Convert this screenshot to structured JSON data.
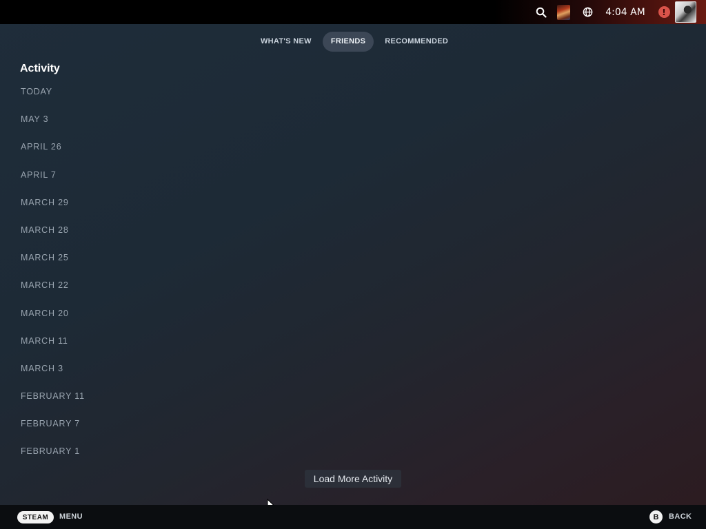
{
  "status_bar": {
    "time": "4:04 AM",
    "icons": [
      "search-icon",
      "game-thumbnail",
      "globe-icon",
      "alert-icon",
      "avatar"
    ],
    "alert_symbol": "!"
  },
  "tabs": [
    {
      "label": "WHAT'S NEW",
      "active": false
    },
    {
      "label": "FRIENDS",
      "active": true
    },
    {
      "label": "RECOMMENDED",
      "active": false
    }
  ],
  "activity": {
    "title": "Activity",
    "dates": [
      "TODAY",
      "MAY 3",
      "APRIL 26",
      "APRIL 7",
      "MARCH 29",
      "MARCH 28",
      "MARCH 25",
      "MARCH 22",
      "MARCH 20",
      "MARCH 11",
      "MARCH 3",
      "FEBRUARY 11",
      "FEBRUARY 7",
      "FEBRUARY 1"
    ],
    "load_more_label": "Load More Activity"
  },
  "footer": {
    "steam_label": "STEAM",
    "menu_label": "MENU",
    "b_label": "B",
    "back_label": "BACK"
  },
  "colors": {
    "alert": "#d9534a",
    "active_tab": "#3c4756"
  }
}
